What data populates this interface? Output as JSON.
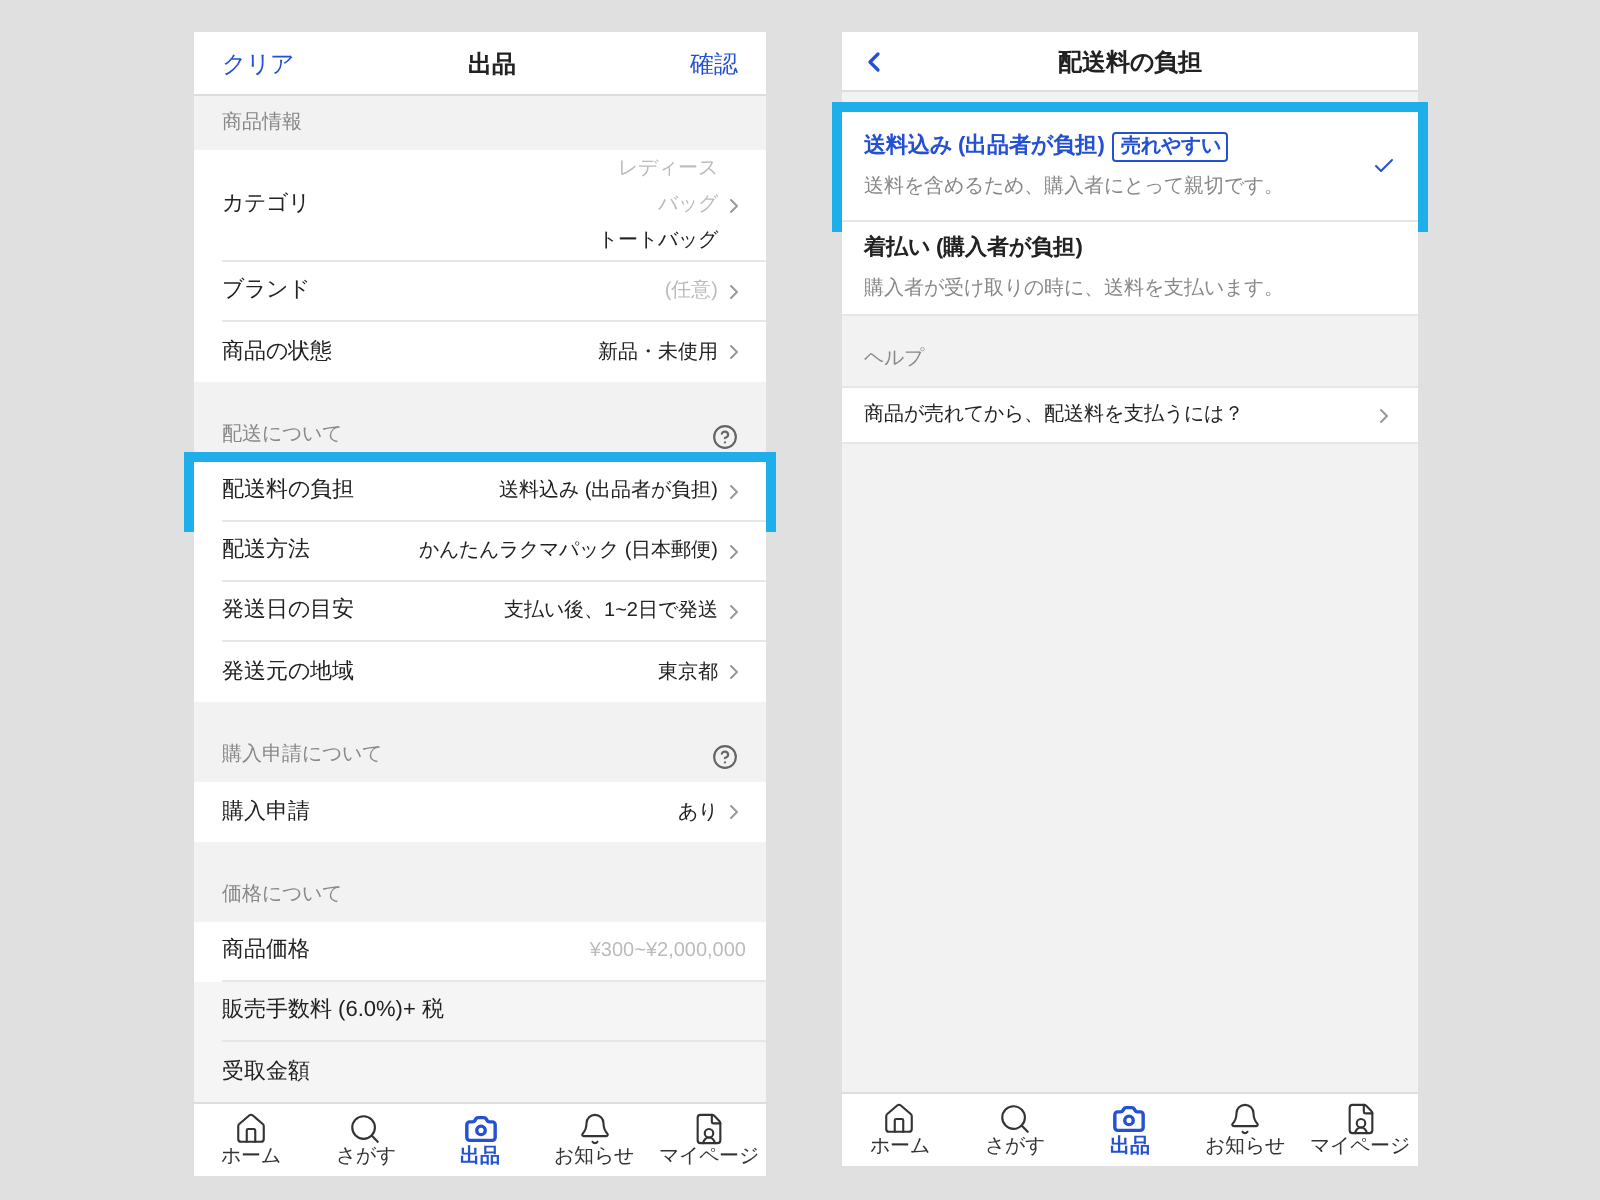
{
  "left": {
    "header": {
      "left": "クリア",
      "title": "出品",
      "right": "確認"
    },
    "sections": [
      {
        "title": "商品情報",
        "help": false,
        "rows": [
          {
            "kind": "category",
            "label": "カテゴリ",
            "path": [
              "レディース",
              "バッグ"
            ],
            "value": "トートバッグ",
            "chevron": true,
            "highlighted": false
          },
          {
            "kind": "select",
            "label": "ブランド",
            "value": "(任意)",
            "placeholder": true,
            "chevron": true,
            "highlighted": false
          },
          {
            "kind": "select",
            "label": "商品の状態",
            "value": "新品・未使用",
            "placeholder": false,
            "chevron": true,
            "highlighted": false
          }
        ]
      },
      {
        "title": "配送について",
        "help": true,
        "rows": [
          {
            "kind": "select",
            "label": "配送料の負担",
            "value": "送料込み (出品者が負担)",
            "placeholder": false,
            "chevron": true,
            "highlighted": true
          },
          {
            "kind": "select",
            "label": "配送方法",
            "value": "かんたんラクマパック (日本郵便)",
            "placeholder": false,
            "chevron": true,
            "highlighted": false
          },
          {
            "kind": "select",
            "label": "発送日の目安",
            "value": "支払い後、1~2日で発送",
            "placeholder": false,
            "chevron": true,
            "highlighted": false
          },
          {
            "kind": "select",
            "label": "発送元の地域",
            "value": "東京都",
            "placeholder": false,
            "chevron": true,
            "highlighted": false
          }
        ]
      },
      {
        "title": "購入申請について",
        "help": true,
        "rows": [
          {
            "kind": "select",
            "label": "購入申請",
            "value": "あり",
            "placeholder": false,
            "chevron": true,
            "highlighted": false
          }
        ]
      },
      {
        "title": "価格について",
        "help": false,
        "rows": [
          {
            "kind": "select",
            "label": "商品価格",
            "value": "¥300~¥2,000,000",
            "placeholder": true,
            "chevron": false,
            "highlighted": false
          },
          {
            "kind": "readonly",
            "label": "販売手数料 (6.0%)+ 税",
            "highlighted": false
          },
          {
            "kind": "readonly",
            "label": "受取金額",
            "highlighted": false
          }
        ]
      }
    ],
    "tabs": [
      {
        "label": "ホーム",
        "selected": false
      },
      {
        "label": "さがす",
        "selected": false
      },
      {
        "label": "出品",
        "selected": true
      },
      {
        "label": "お知らせ",
        "selected": false
      },
      {
        "label": "マイページ",
        "selected": false
      }
    ]
  },
  "right": {
    "header": {
      "title": "配送料の負担"
    },
    "options": [
      {
        "title": "送料込み (出品者が負担)",
        "badge": "売れやすい",
        "description": "送料を含めるため、購入者にとって親切です。",
        "selected": true,
        "highlighted": true
      },
      {
        "title": "着払い (購入者が負担)",
        "description": "購入者が受け取りの時に、送料を支払います。",
        "selected": false,
        "highlighted": false
      }
    ],
    "help_section": {
      "title": "ヘルプ",
      "rows": [
        {
          "label": "商品が売れてから、配送料を支払うには？"
        }
      ]
    },
    "tabs": [
      {
        "label": "ホーム",
        "selected": false
      },
      {
        "label": "さがす",
        "selected": false
      },
      {
        "label": "出品",
        "selected": true
      },
      {
        "label": "お知らせ",
        "selected": false
      },
      {
        "label": "マイページ",
        "selected": false
      }
    ]
  }
}
